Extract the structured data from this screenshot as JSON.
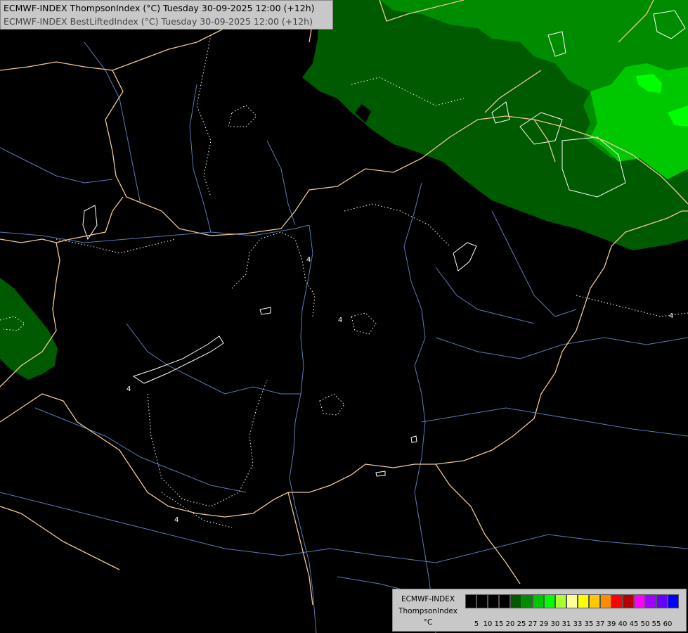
{
  "header": {
    "line1": "ECMWF-INDEX ThompsonIndex (°C) Tuesday 30-09-2025 12:00 (+12h)",
    "line2": "ECMWF-INDEX BestLiftedIndex (°C) Tuesday 30-09-2025 12:00 (+12h)"
  },
  "map_labels": {
    "contour_label": "4"
  },
  "legend": {
    "name_line1": "ECMWF-INDEX",
    "name_line2": "ThompsonIndex",
    "unit": "°C",
    "levels": [
      "5",
      "10",
      "15",
      "20",
      "25",
      "27",
      "29",
      "30",
      "31",
      "33",
      "35",
      "37",
      "39",
      "40",
      "45",
      "50",
      "55",
      "60"
    ],
    "colors": [
      "#000000",
      "#000000",
      "#000000",
      "#000000",
      "#005a00",
      "#008c00",
      "#00c800",
      "#00ff00",
      "#aaff32",
      "#ffff9a",
      "#ffff00",
      "#ffc800",
      "#ff8c00",
      "#ff0000",
      "#b40000",
      "#ff00ff",
      "#a000ff",
      "#6400ff",
      "#0000ff"
    ]
  },
  "colors": {
    "background": "#000000",
    "borders": "#f0c896",
    "rivers": "#5a7ab4",
    "contours": "#ffffff",
    "green_dark": "#005a00",
    "green_mid": "#008c00",
    "green_bright": "#00c800",
    "green_neon": "#00ff00"
  }
}
